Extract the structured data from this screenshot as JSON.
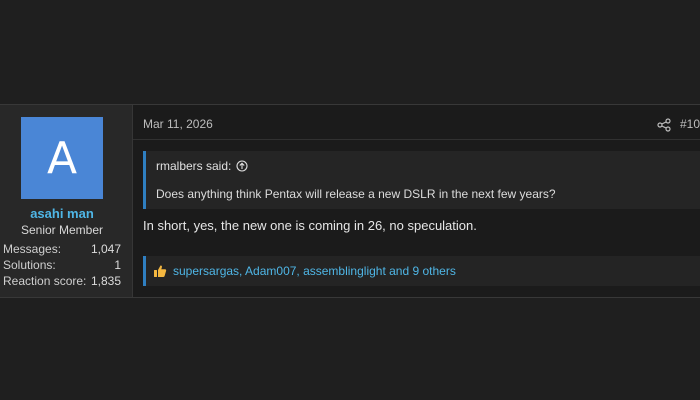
{
  "post": {
    "user": {
      "avatar_letter": "A",
      "avatar_color": "#4a86d6",
      "name": "asahi man",
      "title": "Senior Member",
      "stats": [
        {
          "label": "Messages:",
          "value": "1,047"
        },
        {
          "label": "Solutions:",
          "value": "1"
        },
        {
          "label": "Reaction score:",
          "value": "1,835"
        }
      ]
    },
    "date": "Mar 11, 2026",
    "number": "#10",
    "share_icon": "share-icon",
    "quote": {
      "author_line": "rmalbers said:",
      "jump_icon": "arrow-up-circle-icon",
      "text": "Does anything think Pentax will release a new DSLR in the next few years?"
    },
    "body": "In short, yes, the new one is coming in 26, no speculation.",
    "reactions": {
      "icon": "thumbs-up-icon",
      "text": "supersargas, Adam007, assemblinglight and 9 others"
    },
    "colors": {
      "accent": "#2f7fc1",
      "link": "#4fb6e6",
      "background": "#1f1f1f"
    }
  }
}
